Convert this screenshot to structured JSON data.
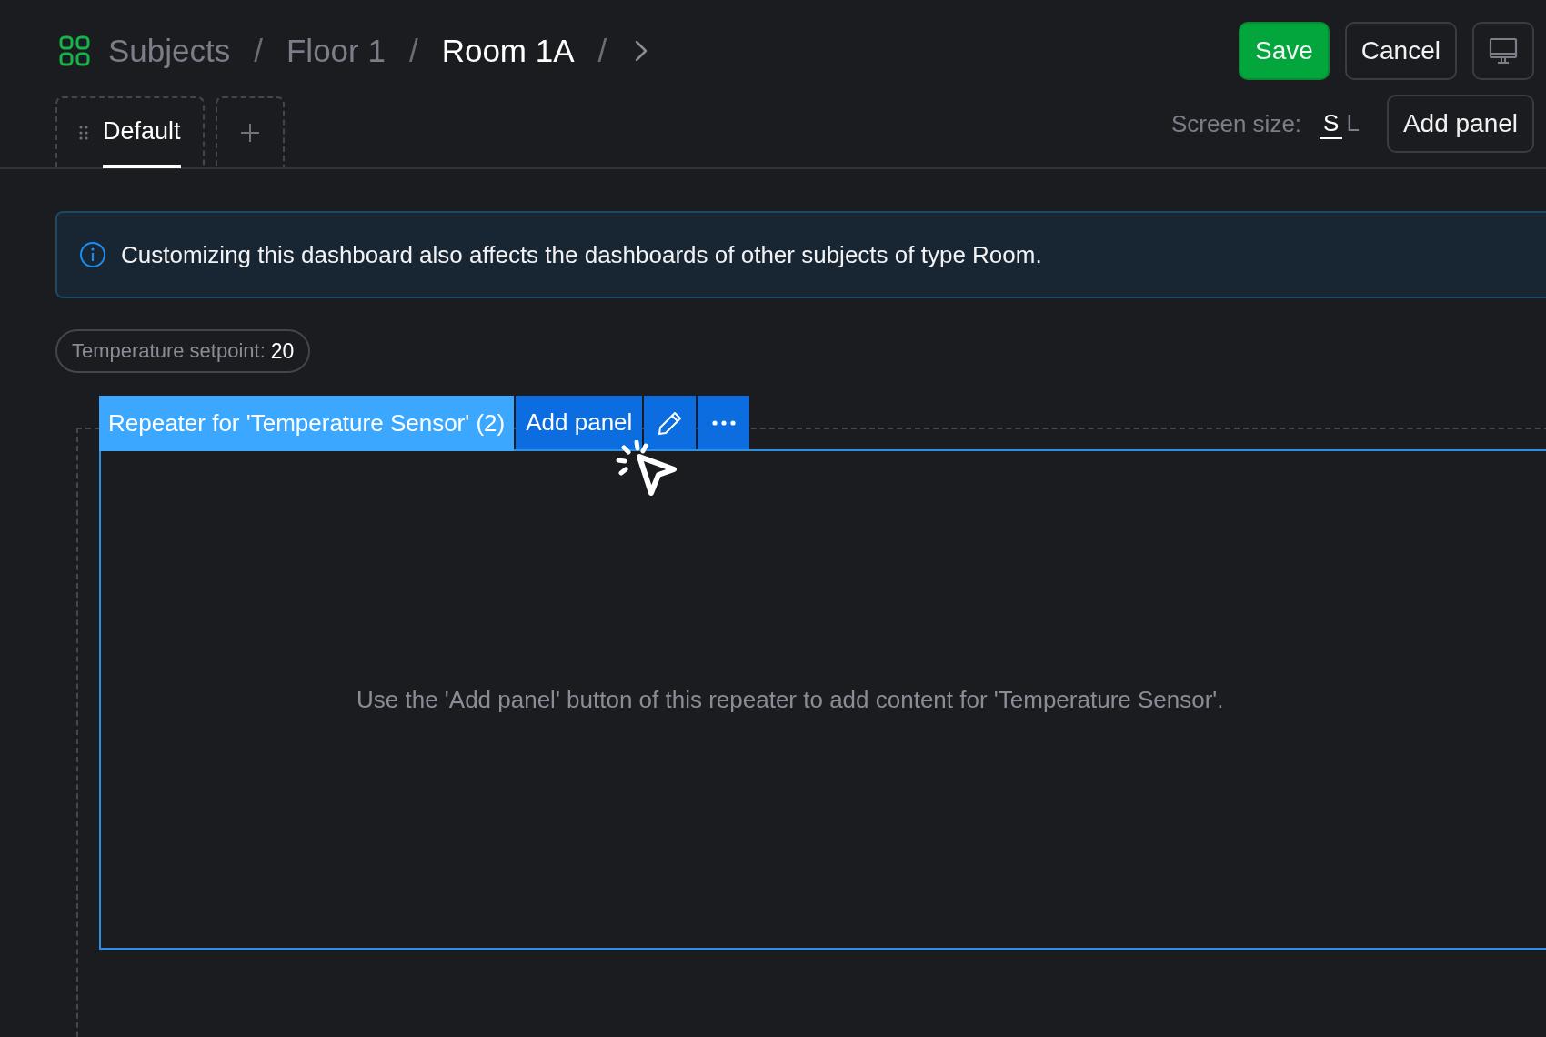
{
  "breadcrumb": {
    "items": [
      {
        "label": "Subjects",
        "separator": "/",
        "current": false
      },
      {
        "label": "Floor 1",
        "separator": "/",
        "current": false
      },
      {
        "label": "Room 1A",
        "separator": "/",
        "current": true
      }
    ]
  },
  "actions": [
    {
      "label": "Save",
      "kind": "primary"
    },
    {
      "label": "Cancel",
      "kind": "secondary"
    },
    {
      "kind": "monitor"
    }
  ],
  "tabs": [
    {
      "label": "Default",
      "selected": true
    }
  ],
  "screen_size": {
    "label": "Screen size:",
    "options": [
      {
        "label": "S",
        "selected": true
      },
      {
        "label": "L",
        "selected": false
      }
    ]
  },
  "add_panel_button": "Add panel",
  "info_banner": "Customizing this dashboard also affects the dashboards of other subjects of type Room.",
  "setpoint_chip": {
    "label": "Temperature setpoint:",
    "value": "20"
  },
  "repeater": {
    "title": "Repeater for 'Temperature Sensor' (2)",
    "add_panel_button": "Add panel",
    "empty_message": "Use the 'Add panel' button of this repeater to add content for 'Temperature Sensor'."
  }
}
